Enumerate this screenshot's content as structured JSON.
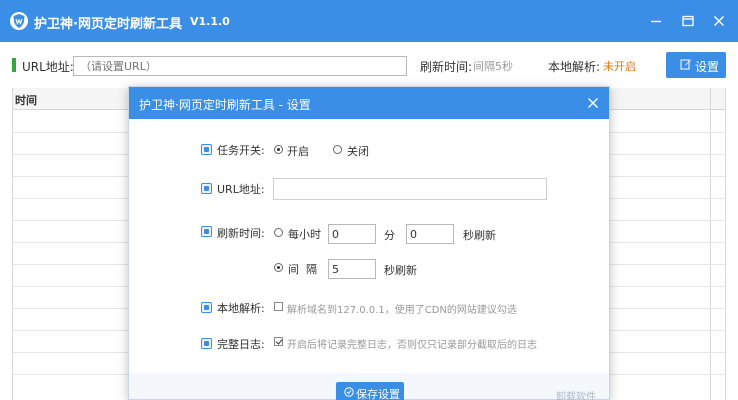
{
  "app": {
    "title": "护卫神·网页定时刷新工具",
    "version": "V1.1.0"
  },
  "toolbar": {
    "url_label": "URL地址:",
    "url_placeholder": "（请设置URL）",
    "refresh_label": "刷新时间:",
    "refresh_value": "间隔5秒",
    "dns_label": "本地解析:",
    "dns_value": "未开启",
    "settings_button": "设置"
  },
  "table": {
    "columns": [
      "时间"
    ]
  },
  "dialog": {
    "title": "护卫神·网页定时刷新工具 - 设置",
    "task_switch_label": "任务开关:",
    "task_on": "开启",
    "task_off": "关闭",
    "url_label": "URL地址:",
    "url_value": "",
    "refresh_label": "刷新时间:",
    "hourly_label": "每小时",
    "hourly_minute_value": "0",
    "minute_unit": "分",
    "hourly_second_value": "0",
    "second_refresh_unit": "秒刷新",
    "interval_label": "间  隔",
    "interval_value": "5",
    "dns_label": "本地解析:",
    "dns_hint": "解析域名到127.0.0.1，使用了CDN的网站建议勾选",
    "full_log_label": "完整日志:",
    "full_log_hint": "开启后将记录完整日志，否则仅只记录部分截取后的日志",
    "save_button": "保存设置",
    "uninstall_link": "卸载软件"
  },
  "colors": {
    "accent": "#3a8ee6",
    "warning": "#e07a10",
    "marker": "#2eaa3a"
  }
}
